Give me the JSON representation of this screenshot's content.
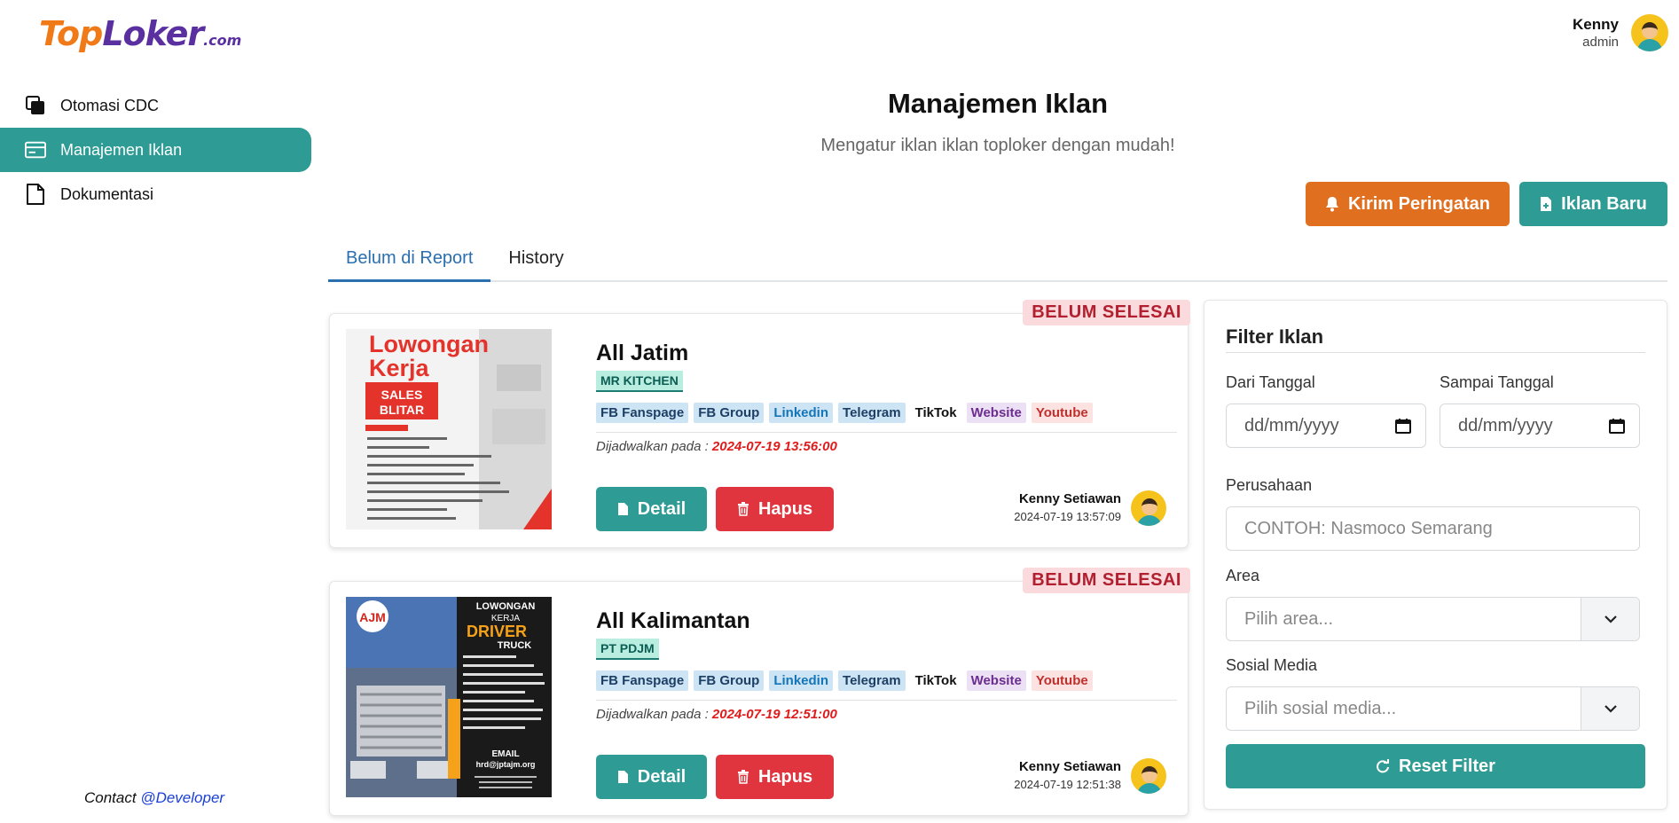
{
  "brand": {
    "logo_top": "Top",
    "logo_loker": "Loker",
    "logo_com": ".com"
  },
  "sidebar": {
    "items": [
      {
        "label": "Otomasi CDC",
        "icon": "copy-icon"
      },
      {
        "label": "Manajemen Iklan",
        "icon": "card-icon",
        "active": true
      },
      {
        "label": "Dokumentasi",
        "icon": "file-icon"
      }
    ],
    "contact_prefix": "Contact ",
    "contact_link": "@Developer"
  },
  "user": {
    "name": "Kenny",
    "role": "admin"
  },
  "header": {
    "title": "Manajemen Iklan",
    "subtitle": "Mengatur iklan iklan toploker dengan mudah!",
    "warn_button": "Kirim Peringatan",
    "new_button": "Iklan Baru"
  },
  "tabs": [
    {
      "label": "Belum di Report",
      "active": true
    },
    {
      "label": "History"
    }
  ],
  "ads": [
    {
      "status": "BELUM SELESAI",
      "title": "All Jatim",
      "company": "MR KITCHEN",
      "tags": [
        "FB Fanspage",
        "FB Group",
        "Linkedin",
        "Telegram",
        "TikTok",
        "Website",
        "Youtube"
      ],
      "scheduled_label": "Dijadwalkan pada : ",
      "scheduled_time": "2024-07-19 13:56:00",
      "detail_label": "Detail",
      "delete_label": "Hapus",
      "creator": "Kenny Setiawan",
      "created_at": "2024-07-19 13:57:09",
      "poster": {
        "line1": "Lowongan",
        "line2": "Kerja",
        "badge1": "SALES",
        "badge2": "BLITAR"
      }
    },
    {
      "status": "BELUM SELESAI",
      "title": "All Kalimantan",
      "company": "PT PDJM",
      "tags": [
        "FB Fanspage",
        "FB Group",
        "Linkedin",
        "Telegram",
        "TikTok",
        "Website",
        "Youtube"
      ],
      "scheduled_label": "Dijadwalkan pada : ",
      "scheduled_time": "2024-07-19 12:51:00",
      "detail_label": "Detail",
      "delete_label": "Hapus",
      "creator": "Kenny Setiawan",
      "created_at": "2024-07-19 12:51:38",
      "poster": {
        "line1": "LOWONGAN",
        "line2": "KERJA",
        "badge1": "DRIVER",
        "badge2": "TRUCK",
        "logo": "AJM",
        "email_label": "EMAIL",
        "email": "hrd@jptajm.org"
      }
    }
  ],
  "filter": {
    "title": "Filter Iklan",
    "from_label": "Dari Tanggal",
    "from_value": "dd/mm/yyyy",
    "to_label": "Sampai Tanggal",
    "to_value": "dd/mm/yyyy",
    "company_label": "Perusahaan",
    "company_placeholder": "CONTOH: Nasmoco Semarang",
    "area_label": "Area",
    "area_placeholder": "Pilih area...",
    "social_label": "Sosial Media",
    "social_placeholder": "Pilih sosial media...",
    "reset_label": "Reset Filter"
  },
  "colors": {
    "primary": "#2e9b95",
    "warning": "#e07020",
    "danger": "#e0353e",
    "link": "#2a6fb0"
  }
}
